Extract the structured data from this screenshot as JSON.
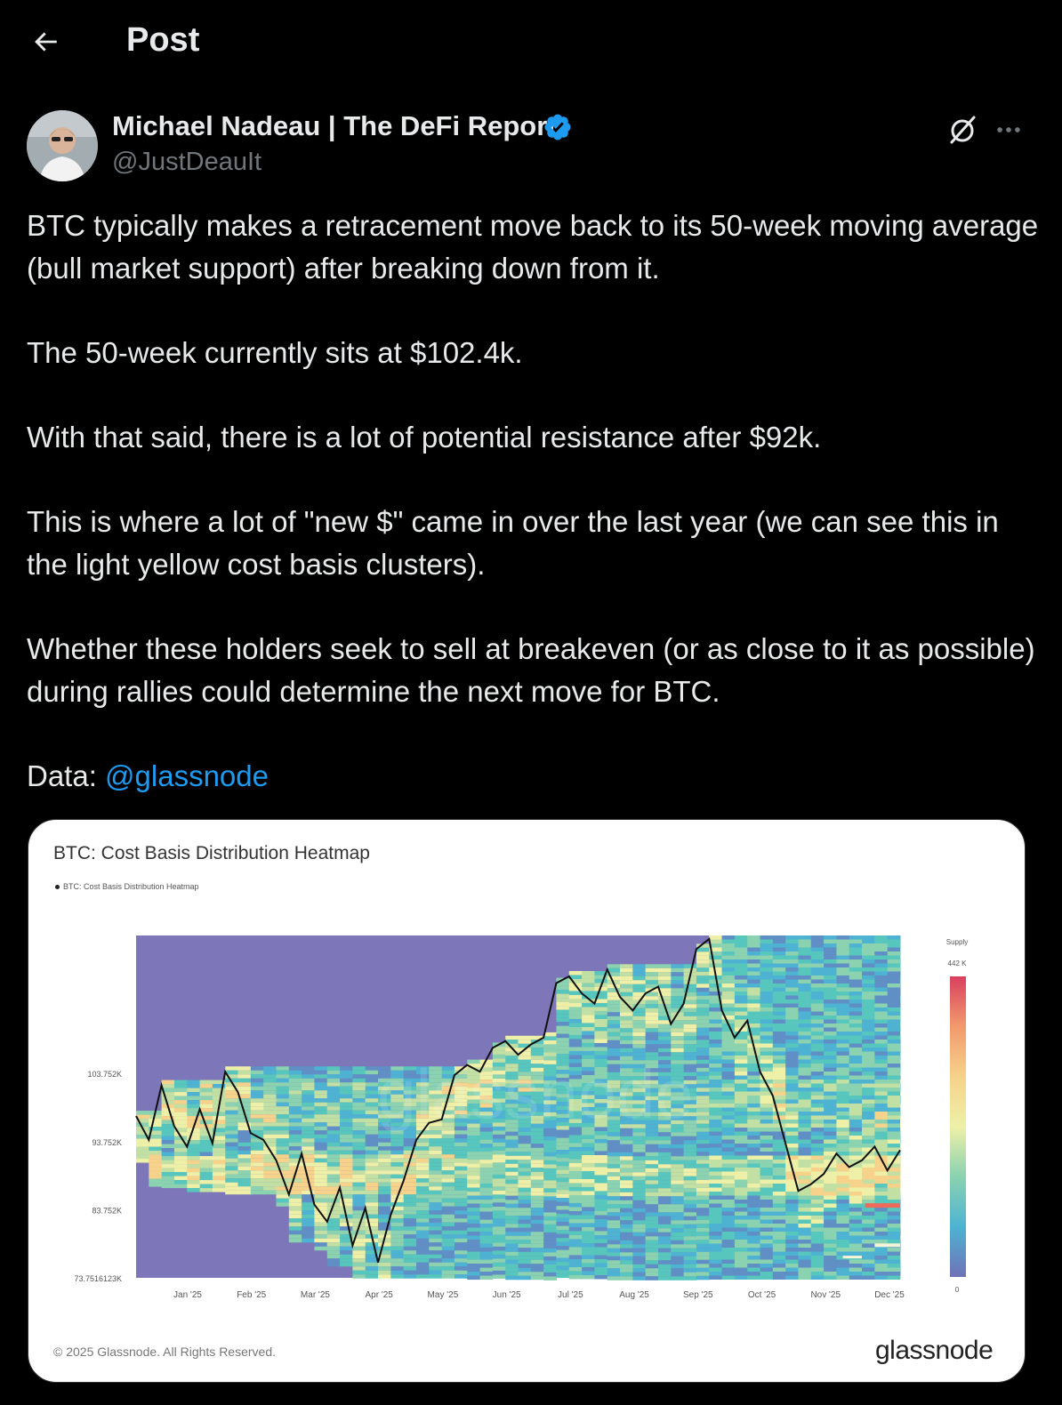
{
  "header": {
    "title": "Post"
  },
  "author": {
    "name": "Michael Nadeau | The DeFi Report",
    "handle": "@JustDeauIt"
  },
  "tweet": {
    "paragraphs": [
      "BTC typically makes a retracement move back to its 50-week moving average (bull market support) after breaking down from it.",
      "The 50-week currently sits at $102.4k.",
      "With that said, there is a lot of potential resistance after $92k.",
      "This is where a lot of \"new $\" came in over the last year (we can see this in the light yellow cost basis clusters).",
      "Whether these holders seek to sell at breakeven (or as close to it as possible) during rallies could determine the next move for BTC."
    ],
    "data_prefix": "Data: ",
    "data_mention": "@glassnode"
  },
  "media": {
    "copyright": "© 2025 Glassnode. All Rights Reserved.",
    "brand": "glassnode",
    "watermark": "glassnode"
  },
  "colors": {
    "mention": "#1d9bf0",
    "verified": "#1d9bf0",
    "background": "#000000"
  },
  "icons": {
    "back": "arrow-left-icon",
    "verified": "verified-badge-icon",
    "grok": "grok-icon",
    "more": "more-icon"
  },
  "chart_data": {
    "type": "heatmap",
    "title": "BTC: Cost Basis Distribution Heatmap",
    "legend": [
      "BTC: Cost Basis Distribution Heatmap"
    ],
    "x_ticks": [
      "Jan '25",
      "Feb '25",
      "Mar '25",
      "Apr '25",
      "May '25",
      "Jun '25",
      "Jul '25",
      "Aug '25",
      "Sep '25",
      "Oct '25",
      "Nov '25",
      "Dec '25"
    ],
    "y_ticks": [
      "103.752K",
      "93.752K",
      "83.752K",
      "73.7516123K"
    ],
    "y_tick_values": [
      103752,
      93752,
      83752,
      73751.6123
    ],
    "ylim": [
      73751.6123,
      124000
    ],
    "colorbar": {
      "title": "Supply",
      "max_label": "442 K",
      "min_label": "0"
    },
    "price_series": {
      "name": "BTC price",
      "x_month": [
        0.0,
        0.2,
        0.4,
        0.6,
        0.8,
        1.0,
        1.2,
        1.4,
        1.6,
        1.8,
        2.0,
        2.2,
        2.4,
        2.6,
        2.8,
        3.0,
        3.2,
        3.4,
        3.6,
        3.8,
        4.0,
        4.2,
        4.4,
        4.6,
        4.8,
        5.0,
        5.2,
        5.4,
        5.6,
        5.8,
        6.0,
        6.2,
        6.4,
        6.6,
        6.8,
        7.0,
        7.2,
        7.4,
        7.6,
        7.8,
        8.0,
        8.2,
        8.4,
        8.6,
        8.8,
        9.0,
        9.2,
        9.4,
        9.6,
        9.8,
        10.0,
        10.2,
        10.4,
        10.6,
        10.8,
        11.0,
        11.2,
        11.4,
        11.6,
        11.8,
        12.0
      ],
      "price": [
        97500,
        94000,
        102000,
        96000,
        93000,
        98500,
        93500,
        104000,
        101000,
        95000,
        94000,
        91000,
        86000,
        92000,
        84500,
        82000,
        87000,
        78500,
        84000,
        76000,
        83000,
        88000,
        94000,
        96500,
        97000,
        103500,
        105000,
        104000,
        107500,
        108500,
        106500,
        108000,
        109000,
        117000,
        118000,
        115500,
        114000,
        119000,
        115000,
        113000,
        115500,
        116500,
        111000,
        114000,
        122000,
        123500,
        113000,
        109000,
        111500,
        104000,
        100500,
        93500,
        86500,
        87500,
        89000,
        92000,
        90000,
        91000,
        93000,
        89500,
        92500
      ]
    }
  }
}
